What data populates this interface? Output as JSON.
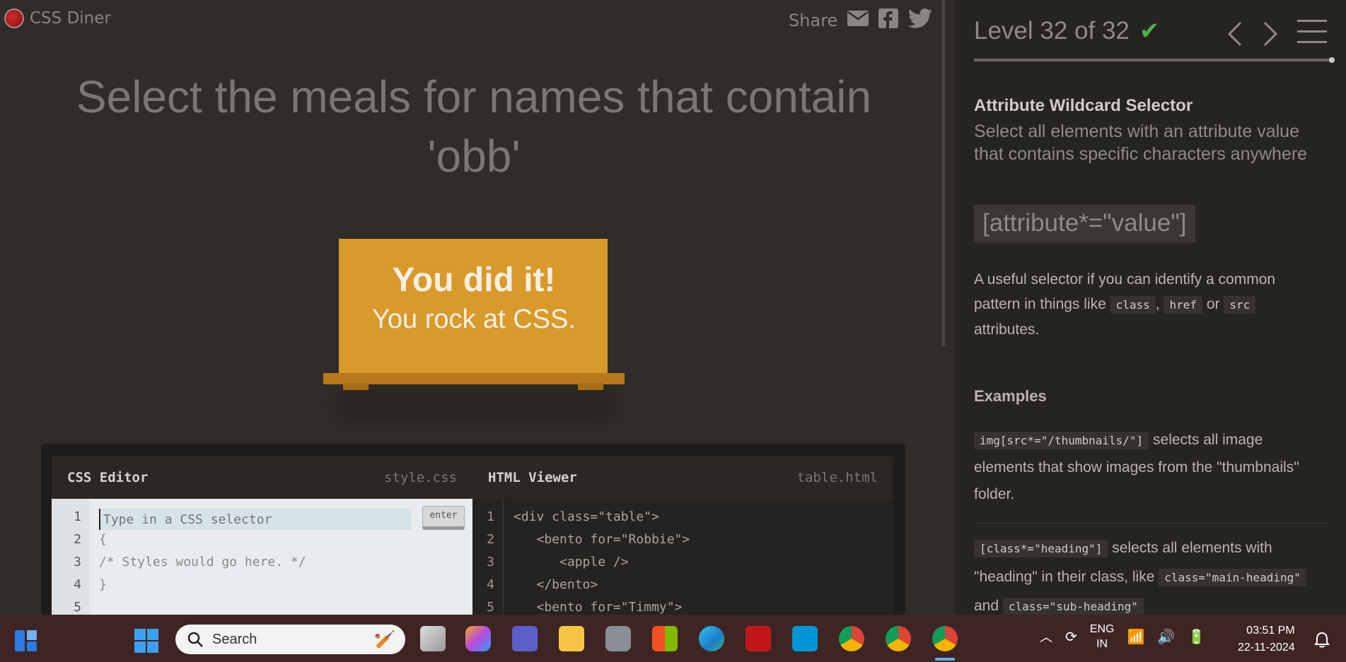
{
  "header": {
    "app_name": "CSS Diner",
    "share_label": "Share"
  },
  "instruction": "Select the meals for names that contain 'obb'",
  "win": {
    "title": "You did it!",
    "subtitle": "You rock at CSS."
  },
  "editor": {
    "css_title": "CSS Editor",
    "css_file": "style.css",
    "html_title": "HTML Viewer",
    "html_file": "table.html",
    "input_placeholder": "Type in a CSS selector",
    "enter_label": "enter",
    "css_line_numbers": [
      "1",
      "2",
      "3",
      "4",
      "5"
    ],
    "css_lines": [
      "{",
      "/* Styles would go here. */",
      "}"
    ],
    "html_line_numbers": [
      "1",
      "2",
      "3",
      "4",
      "5"
    ],
    "html_lines": [
      "<div class=\"table\">",
      "   <bento for=\"Robbie\">",
      "      <apple />",
      "   </bento>",
      "   <bento for=\"Timmy\">"
    ]
  },
  "sidebar": {
    "level_text": "Level 32 of 32",
    "check": "✔",
    "selector_name": "Attribute Wildcard Selector",
    "selector_title": "Select all elements with an attribute value that contains specific characters anywhere",
    "syntax": "[attribute*=\"value\"]",
    "hint": {
      "text1": "A useful selector if you can identify a common pattern in things like",
      "code1": "class",
      "sep1": ",",
      "code2": "href",
      "sep2": "or",
      "code3": "src",
      "text2": "attributes."
    },
    "examples_title": "Examples",
    "example1": {
      "code": "img[src*=\"/thumbnails/\"]",
      "text": "selects all image elements that show images from the \"thumbnails\" folder."
    },
    "example2": {
      "code": "[class*=\"heading\"]",
      "text1": "selects all elements with \"heading\" in their class, like",
      "code2": "class=\"main-heading\"",
      "and": "and",
      "code3": "class=\"sub-heading\""
    }
  },
  "taskbar": {
    "search_placeholder": "Search",
    "lang_line1": "ENG",
    "lang_line2": "IN",
    "time": "03:51 PM",
    "date": "22-11-2024"
  },
  "colors": {
    "background": "#2f2c29",
    "sidebar": "#262421",
    "table": "#d99a2c",
    "check": "#4caf50",
    "taskbar": "#3e2524"
  }
}
